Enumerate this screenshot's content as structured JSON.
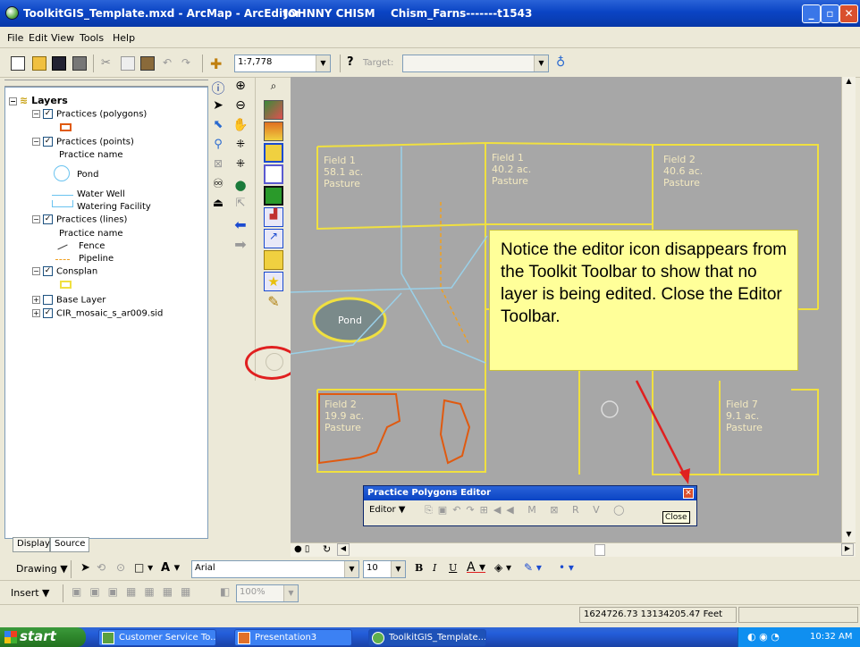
{
  "window": {
    "title": "ToolkitGIS_Template.mxd - ArcMap - ArcEditor",
    "user": "JOHNNY CHISM",
    "project": "Chism_Farns-------t1543"
  },
  "menu": [
    "File",
    "Edit",
    "View",
    "Tools",
    "Help"
  ],
  "toolbar": {
    "scale": "1:7,778",
    "target_label": "Target:"
  },
  "toc": {
    "root": "Layers",
    "items": [
      {
        "label": "Practices (polygons)",
        "checked": true
      },
      {
        "label": "Practices (points)",
        "checked": true
      },
      {
        "label": "Practice name"
      },
      {
        "label": "Pond"
      },
      {
        "label": "Water Well"
      },
      {
        "label": "Watering Facility"
      },
      {
        "label": "Practices (lines)",
        "checked": true
      },
      {
        "label": "Practice name"
      },
      {
        "label": "Fence"
      },
      {
        "label": "Pipeline"
      },
      {
        "label": "Consplan",
        "checked": true
      },
      {
        "label": "Base Layer",
        "checked": false
      },
      {
        "label": "CIR_mosaic_s_ar009.sid",
        "checked": true
      }
    ],
    "tabs": [
      "Display",
      "Source"
    ]
  },
  "map": {
    "fields": [
      {
        "name": "Field 1",
        "acres": "58.1 ac.",
        "use": "Pasture"
      },
      {
        "name": "Field 1",
        "acres": "40.2 ac.",
        "use": "Pasture"
      },
      {
        "name": "Field 2",
        "acres": "40.6 ac.",
        "use": "Pasture"
      },
      {
        "name": "Field 2",
        "acres": "19.9 ac.",
        "use": "Pasture"
      },
      {
        "name": "Field 7",
        "acres": "9.1 ac.",
        "use": "Pasture"
      }
    ],
    "pond_label": "Pond"
  },
  "callout": "Notice the editor icon disappears from the Toolkit Toolbar to show that no layer is being edited. Close the Editor Toolbar.",
  "editor": {
    "title": "Practice Polygons Editor",
    "menu": "Editor",
    "tooltip": "Close"
  },
  "drawing": {
    "label": "Drawing",
    "font": "Arial",
    "size": "10"
  },
  "insert": {
    "label": "Insert",
    "zoom": "100%"
  },
  "status": {
    "coords": "1624726.73  13134205.47 Feet"
  },
  "taskbar": {
    "start": "start",
    "tasks": [
      "Customer Service To...",
      "Presentation3",
      "ToolkitGIS_Template...."
    ],
    "time": "10:32 AM"
  }
}
